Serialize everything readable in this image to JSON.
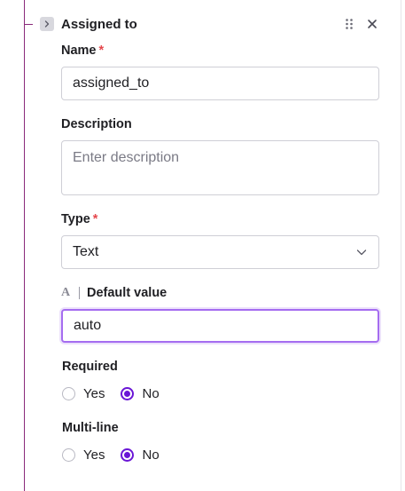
{
  "panel": {
    "title": "Assigned to"
  },
  "fields": {
    "name": {
      "label": "Name",
      "required_mark": "*",
      "value": "assigned_to"
    },
    "description": {
      "label": "Description",
      "placeholder": "Enter description"
    },
    "type": {
      "label": "Type",
      "required_mark": "*",
      "selected": "Text"
    },
    "default_value": {
      "type_icon_letter": "A",
      "label": "Default value",
      "value": "auto"
    },
    "required": {
      "label": "Required",
      "options": [
        "Yes",
        "No"
      ],
      "selected": "No"
    },
    "multiline": {
      "label": "Multi-line",
      "options": [
        "Yes",
        "No"
      ],
      "selected": "No"
    }
  },
  "icons": {
    "expand": "chevron-right-icon",
    "drag": "drag-handle-icon",
    "close": "close-icon",
    "select": "chevron-down-icon"
  },
  "colors": {
    "accent": "#6a16d6",
    "focus_ring": "#a56cf0",
    "required": "#e5484d",
    "tree_line": "#8a2a7a"
  }
}
